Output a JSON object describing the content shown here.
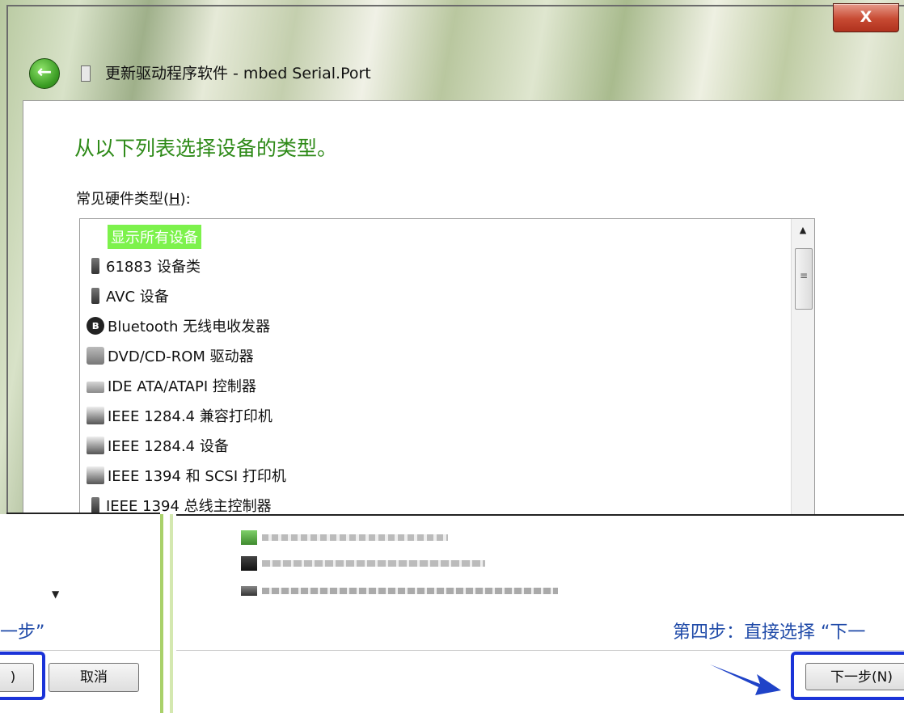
{
  "window": {
    "title": "更新驱动程序软件 - mbed Serial.Port",
    "close_label": "X",
    "back_label": "←"
  },
  "page": {
    "heading": "从以下列表选择设备的类型。",
    "list_label_prefix": "常见硬件类型(",
    "list_label_hotkey": "H",
    "list_label_suffix": "):"
  },
  "device_list": {
    "items": [
      {
        "label": "显示所有设备",
        "icon": "none",
        "selected": true
      },
      {
        "label": "61883 设备类",
        "icon": "usb-plug-icon"
      },
      {
        "label": "AVC 设备",
        "icon": "usb-plug-icon"
      },
      {
        "label": "Bluetooth 无线电收发器",
        "icon": "bluetooth-icon"
      },
      {
        "label": "DVD/CD-ROM 驱动器",
        "icon": "dvd-drive-icon"
      },
      {
        "label": "IDE ATA/ATAPI 控制器",
        "icon": "ide-controller-icon"
      },
      {
        "label": "IEEE 1284.4 兼容打印机",
        "icon": "printer-icon"
      },
      {
        "label": "IEEE 1284.4 设备",
        "icon": "printer-icon"
      },
      {
        "label": "IEEE 1394 和 SCSI 打印机",
        "icon": "printer-icon"
      },
      {
        "label": "IEEE 1394 总线主控制器",
        "icon": "usb-plug-icon"
      }
    ],
    "scroll_up_glyph": "▲",
    "scroll_thumb_glyph": "≡"
  },
  "lower": {
    "blurred_items": [
      "",
      "",
      ""
    ],
    "scroll_down_glyph": "▼"
  },
  "annotations": {
    "left_step": "一步”",
    "right_step": "第四步：直接选择 “下一"
  },
  "buttons": {
    "left_partial": ")",
    "cancel": "取消",
    "next": "下一步(N)"
  },
  "colors": {
    "heading_green": "#2e8a18",
    "selection_green": "#7df24c",
    "annotation_blue": "#1f4aa8",
    "highlight_box_blue": "#1a33d8"
  }
}
